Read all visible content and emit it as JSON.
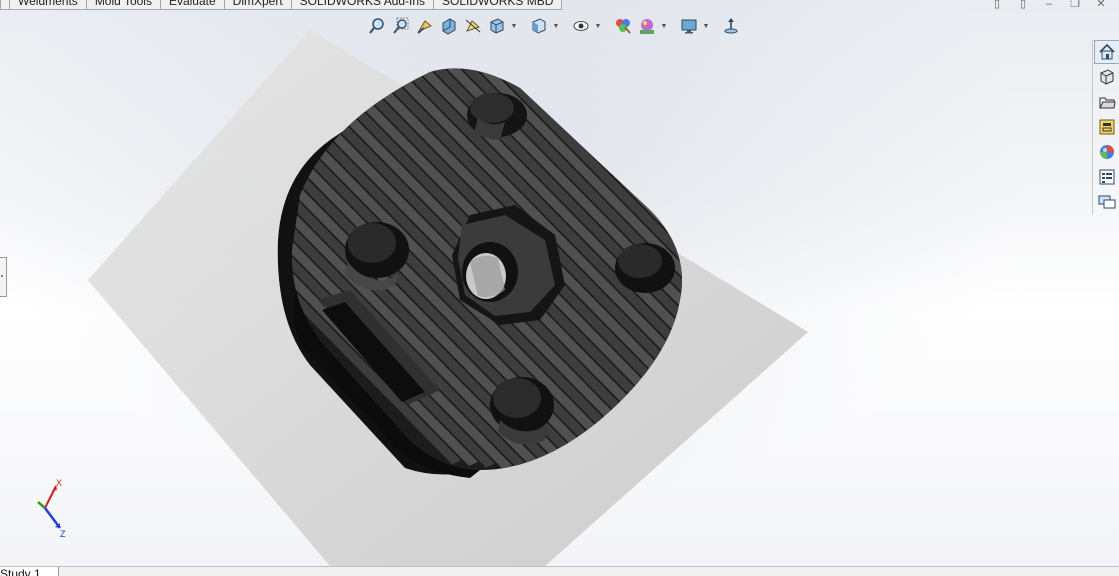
{
  "command_manager": {
    "tabs": [
      {
        "label": ""
      },
      {
        "label": "Weldments"
      },
      {
        "label": "Mold Tools"
      },
      {
        "label": "Evaluate"
      },
      {
        "label": "DimXpert"
      },
      {
        "label": "SOLIDWORKS Add-Ins"
      },
      {
        "label": "SOLIDWORKS MBD"
      }
    ]
  },
  "headsup_toolbar": {
    "tools": [
      {
        "icon": "zoom-to-fit-icon"
      },
      {
        "icon": "zoom-to-area-icon"
      },
      {
        "icon": "previous-view-icon"
      },
      {
        "icon": "section-view-icon"
      },
      {
        "icon": "dynamic-annotation-views-icon"
      },
      {
        "icon": "view-orientation-icon"
      },
      {
        "icon": "display-style-icon"
      },
      {
        "icon": "hide-show-items-icon"
      },
      {
        "icon": "edit-appearance-icon"
      },
      {
        "icon": "apply-scene-icon"
      },
      {
        "icon": "view-settings-icon"
      },
      {
        "icon": "rotate-view-icon"
      }
    ]
  },
  "task_pane": {
    "buttons": [
      {
        "icon": "solidworks-resources-icon"
      },
      {
        "icon": "design-library-icon"
      },
      {
        "icon": "file-explorer-icon"
      },
      {
        "icon": "view-palette-icon"
      },
      {
        "icon": "appearances-scenes-icon"
      },
      {
        "icon": "custom-properties-icon"
      },
      {
        "icon": "solidworks-forum-icon"
      }
    ]
  },
  "triad": {
    "x_label": "X",
    "z_label": "Z"
  },
  "status_bar": {
    "study_tab": "Study 1"
  },
  "colors": {
    "model_body": "#1a1a1a",
    "model_edge": "#000000",
    "model_highlight": "#4a4a4a",
    "plane": "#d8d8d8",
    "x_axis": "#d22020",
    "y_axis": "#2aa02a",
    "z_axis": "#2040d0"
  }
}
